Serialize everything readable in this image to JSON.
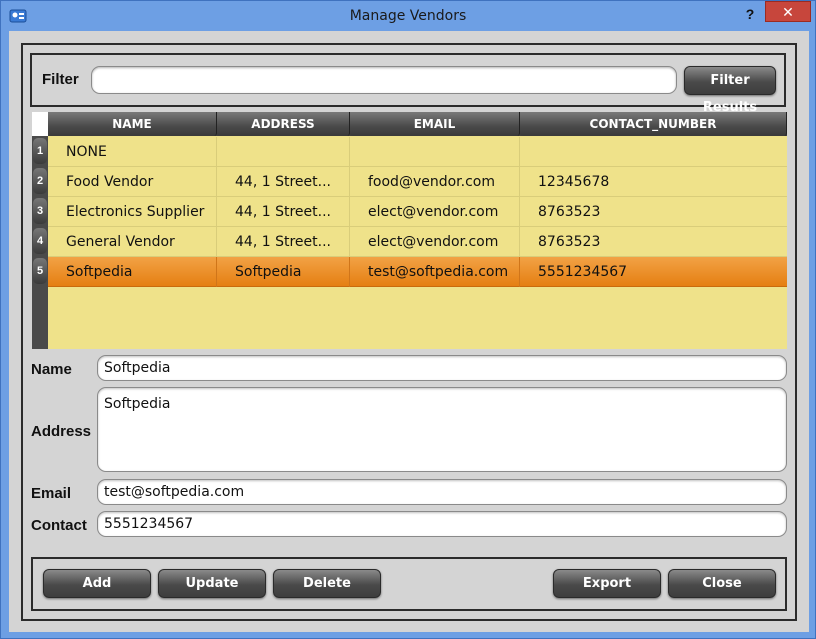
{
  "window": {
    "title": "Manage Vendors",
    "help_label": "?",
    "close_label": "✕"
  },
  "filter": {
    "label": "Filter",
    "value": "",
    "placeholder": "",
    "button_label": "Filter Results"
  },
  "grid": {
    "columns": [
      "NAME",
      "ADDRESS",
      "EMAIL",
      "CONTACT_NUMBER"
    ],
    "rows": [
      {
        "num": "1",
        "name": "NONE",
        "address": "",
        "email": "",
        "contact": ""
      },
      {
        "num": "2",
        "name": "Food Vendor",
        "address": "44, 1 Street...",
        "email": "food@vendor.com",
        "contact": "12345678"
      },
      {
        "num": "3",
        "name": "Electronics Supplier",
        "address": "44, 1 Street...",
        "email": "elect@vendor.com",
        "contact": "8763523"
      },
      {
        "num": "4",
        "name": "General Vendor",
        "address": "44, 1 Street...",
        "email": "elect@vendor.com",
        "contact": "8763523"
      },
      {
        "num": "5",
        "name": "Softpedia",
        "address": "Softpedia",
        "email": "test@softpedia.com",
        "contact": "5551234567"
      }
    ],
    "selected_row": 5
  },
  "form": {
    "name_label": "Name",
    "name_value": "Softpedia",
    "address_label": "Address",
    "address_value": "Softpedia",
    "email_label": "Email",
    "email_value": "test@softpedia.com",
    "contact_label": "Contact",
    "contact_value": "5551234567"
  },
  "buttons": {
    "add": "Add",
    "update": "Update",
    "delete": "Delete",
    "export": "Export",
    "close": "Close"
  },
  "colors": {
    "title_bar": "#6d9fe4",
    "grid_bg": "#efe28a",
    "selected_row": "#e57f12",
    "close_button": "#c7463c"
  },
  "icons": {
    "app": "vendor-app-icon"
  }
}
